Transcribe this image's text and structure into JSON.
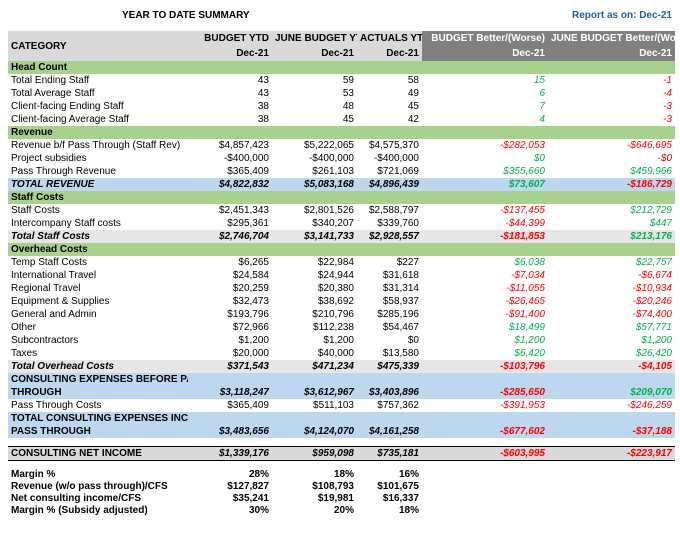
{
  "title": "YEAR TO DATE SUMMARY",
  "report_as_on": "Report as on: Dec-21",
  "columns": {
    "category": "CATEGORY",
    "budget_ytd": "BUDGET YTD",
    "june_budget_ytd": "JUNE BUDGET YTD",
    "actuals_ytd": "ACTUALS YTD",
    "budget_better_worse": "BUDGET Better/(Worse)",
    "june_budget_better_worse": "JUNE BUDGET Better/(Worse)",
    "period": "Dec-21"
  },
  "colors": {
    "section": "#a9d18e",
    "total": "#bdd7ee",
    "header": "#d9d9d9",
    "header_dark": "#808080",
    "positive": "#00b050",
    "negative": "#ff0000",
    "report_link": "#1f5fa8"
  },
  "sections": {
    "head_count": {
      "label": "Head Count",
      "rows": [
        {
          "label": "Total Ending Staff",
          "budget": "43",
          "june": "59",
          "actual": "58",
          "bud_var": "15",
          "june_var": "-1"
        },
        {
          "label": "Total Average Staff",
          "budget": "43",
          "june": "53",
          "actual": "49",
          "bud_var": "6",
          "june_var": "-4"
        },
        {
          "label": "Client-facing Ending Staff",
          "budget": "38",
          "june": "48",
          "actual": "45",
          "bud_var": "7",
          "june_var": "-3"
        },
        {
          "label": "Client-facing Average Staff",
          "budget": "38",
          "june": "45",
          "actual": "42",
          "bud_var": "4",
          "june_var": "-3"
        }
      ]
    },
    "revenue": {
      "label": "Revenue",
      "rows": [
        {
          "label": "Revenue b/f Pass Through (Staff Rev)",
          "budget": "$4,857,423",
          "june": "$5,222,065",
          "actual": "$4,575,370",
          "bud_var": "-$282,053",
          "june_var": "-$646,695"
        },
        {
          "label": "Project subsidies",
          "budget": "-$400,000",
          "june": "-$400,000",
          "actual": "-$400,000",
          "bud_var": "$0",
          "june_var": "-$0"
        },
        {
          "label": "Pass Through Revenue",
          "budget": "$365,409",
          "june": "$261,103",
          "actual": "$721,069",
          "bud_var": "$355,660",
          "june_var": "$459,966"
        }
      ],
      "total": {
        "label": "TOTAL REVENUE",
        "budget": "$4,822,832",
        "june": "$5,083,168",
        "actual": "$4,896,439",
        "bud_var": "$73,607",
        "june_var": "-$186,729"
      }
    },
    "staff_costs": {
      "label": "Staff Costs",
      "rows": [
        {
          "label": "Staff Costs",
          "budget": "$2,451,343",
          "june": "$2,801,526",
          "actual": "$2,588,797",
          "bud_var": "-$137,455",
          "june_var": "$212,729"
        },
        {
          "label": "Intercompany Staff costs",
          "budget": "$295,361",
          "june": "$340,207",
          "actual": "$339,760",
          "bud_var": "-$44,399",
          "june_var": "$447"
        }
      ],
      "total": {
        "label": "Total Staff Costs",
        "budget": "$2,746,704",
        "june": "$3,141,733",
        "actual": "$2,928,557",
        "bud_var": "-$181,853",
        "june_var": "$213,176"
      }
    },
    "overhead_costs": {
      "label": "Overhead Costs",
      "rows": [
        {
          "label": "Temp Staff Costs",
          "budget": "$6,265",
          "june": "$22,984",
          "actual": "$227",
          "bud_var": "$6,038",
          "june_var": "$22,757"
        },
        {
          "label": "International Travel",
          "budget": "$24,584",
          "june": "$24,944",
          "actual": "$31,618",
          "bud_var": "-$7,034",
          "june_var": "-$6,674"
        },
        {
          "label": "Regional Travel",
          "budget": "$20,259",
          "june": "$20,380",
          "actual": "$31,314",
          "bud_var": "-$11,055",
          "june_var": "-$10,934"
        },
        {
          "label": "Equipment & Supplies",
          "budget": "$32,473",
          "june": "$38,692",
          "actual": "$58,937",
          "bud_var": "-$26,465",
          "june_var": "-$20,246"
        },
        {
          "label": "General and Admin",
          "budget": "$193,796",
          "june": "$210,796",
          "actual": "$285,196",
          "bud_var": "-$91,400",
          "june_var": "-$74,400"
        },
        {
          "label": "Other",
          "budget": "$72,966",
          "june": "$112,238",
          "actual": "$54,467",
          "bud_var": "$18,499",
          "june_var": "$57,771"
        },
        {
          "label": "Subcontractors",
          "budget": "$1,200",
          "june": "$1,200",
          "actual": "$0",
          "bud_var": "$1,200",
          "june_var": "$1,200"
        },
        {
          "label": "Taxes",
          "budget": "$20,000",
          "june": "$40,000",
          "actual": "$13,580",
          "bud_var": "$6,420",
          "june_var": "$26,420"
        }
      ],
      "total": {
        "label": "Total Overhead Costs",
        "budget": "$371,543",
        "june": "$471,234",
        "actual": "$475,339",
        "bud_var": "-$103,796",
        "june_var": "-$4,105"
      }
    }
  },
  "consulting_before": {
    "label_1": "CONSULTING EXPENSES BEFORE PASS",
    "label_2": "THROUGH",
    "budget": "$3,118,247",
    "june": "$3,612,967",
    "actual": "$3,403,896",
    "bud_var": "-$285,650",
    "june_var": "$209,070"
  },
  "pass_through_costs": {
    "label": "Pass Through Costs",
    "budget": "$365,409",
    "june": "$511,103",
    "actual": "$757,362",
    "bud_var": "-$391,953",
    "june_var": "-$246,259"
  },
  "consulting_total": {
    "label_1": "TOTAL CONSULTING EXPENSES INCL",
    "label_2": "PASS THROUGH",
    "budget": "$3,483,656",
    "june": "$4,124,070",
    "actual": "$4,161,258",
    "bud_var": "-$677,602",
    "june_var": "-$37,188"
  },
  "net_income": {
    "label": "CONSULTING NET INCOME",
    "budget": "$1,339,176",
    "june": "$959,098",
    "actual": "$735,181",
    "bud_var": "-$603,995",
    "june_var": "-$223,917"
  },
  "metrics": [
    {
      "label": "Margin %",
      "budget": "28%",
      "june": "18%",
      "actual": "16%"
    },
    {
      "label": "Revenue (w/o pass through)/CFS",
      "budget": "$127,827",
      "june": "$108,793",
      "actual": "$101,675"
    },
    {
      "label": "Net consulting income/CFS",
      "budget": "$35,241",
      "june": "$19,981",
      "actual": "$16,337"
    },
    {
      "label": "Margin % (Subsidy adjusted)",
      "budget": "30%",
      "june": "20%",
      "actual": "18%"
    }
  ]
}
